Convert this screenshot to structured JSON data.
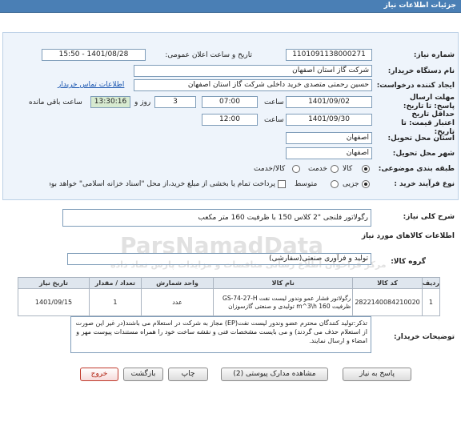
{
  "header": {
    "title": "جزئیات اطلاعات نیاز"
  },
  "fields": {
    "need_number_label": "شماره نیاز:",
    "need_number": "1101091138000271",
    "announce_label": "تاریخ و ساعت اعلان عمومی:",
    "announce_value": "1401/08/28 - 15:50",
    "buyer_label": "نام دستگاه خریدار:",
    "buyer_value": "شرکت گاز استان اصفهان",
    "creator_label": "ایجاد کننده درخواست:",
    "creator_value": "حسین  رحمتی متصدی خرید داخلی شرکت گاز استان اصفهان",
    "contact_link": "اطلاعات تماس خریدار",
    "deadline_label": "مهلت ارسال پاسخ: تا تاریخ:",
    "deadline_date": "1401/09/02",
    "time_label": "ساعت",
    "deadline_time": "07:00",
    "days_value": "3",
    "days_label": "روز و",
    "remaining_time": "13:30:16",
    "remaining_label": "ساعت باقی مانده",
    "validity_label": "حداقل تاریخ اعتبار قیمت: تا تاریخ:",
    "validity_date": "1401/09/30",
    "validity_time": "12:00",
    "province_label": "استان محل تحویل:",
    "province_value": "اصفهان",
    "city_label": "شهر محل تحویل:",
    "city_value": "اصفهان",
    "category_label": "طبقه بندی موضوعی:",
    "category_options": [
      "کالا",
      "خدمت",
      "کالا/خدمت"
    ],
    "process_label": "نوع فرآیند خرید :",
    "process_options": [
      "جزیی",
      "متوسط"
    ],
    "payment_note": "پرداخت تمام یا بخشی از مبلغ خرید،از محل \"اسناد خزانه اسلامی\" خواهد بود."
  },
  "description": {
    "label": "شرح کلی نیاز:",
    "value": "رگولاتور فلنجی \"2 کلاس 150 با ظرفیت 160 متر مکعب"
  },
  "goods": {
    "section_title": "اطلاعات کالاهای مورد نیاز",
    "group_label": "گروه کالا:",
    "group_value": "تولید و فرآوری صنعتی(سفارشی)",
    "columns": [
      "ردیف",
      "کد کالا",
      "نام کالا",
      "واحد شمارش",
      "تعداد / مقدار",
      "تاریخ نیاز"
    ],
    "rows": [
      {
        "index": "1",
        "code": "2822140084210020",
        "name": "رگولاتور فشار عمو وندور لیست نفت GS-74-27-H ظرفیت m^3\\h 160 تولیدی و صنعتی گازسوزان",
        "unit": "عدد",
        "qty": "1",
        "date": "1401/09/15"
      }
    ]
  },
  "notes": {
    "label": "توضیحات خریدار:",
    "text": "تذکر:تولید کنندگان محترم عضو وندور لیست نفت(EP) مجاز به شرکت در استعلام می باشند(در غیر این صورت از استعلام حذف می گردند) و می بایست مشخصات فنی و نقشه ساخت خود را همراه مستندات پیوست مهر و امضاء و ارسال نمایند."
  },
  "buttons": {
    "reply": "پاسخ به نیاز",
    "docs": "مشاهده مدارک پیوستی (2)",
    "print": "چاپ",
    "back": "بازگشت",
    "exit": "خروج"
  },
  "watermark": {
    "brand": "ParsNamadData",
    "subtitle": "مرکز فراخوان اطلاع رسانی مناقصات و مزایدات پارس نماد داده"
  }
}
